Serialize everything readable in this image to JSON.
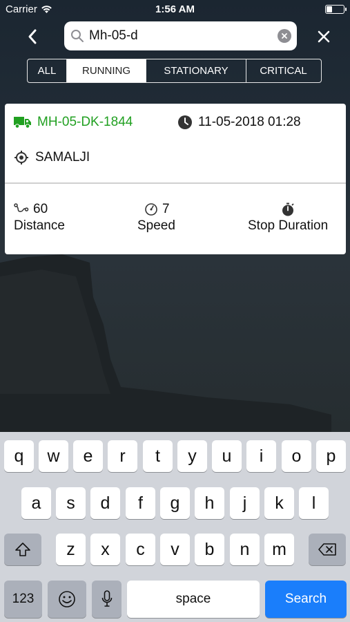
{
  "status_bar": {
    "carrier": "Carrier",
    "time": "1:56 AM"
  },
  "search": {
    "value": "Mh-05-d"
  },
  "filters": [
    {
      "label": "ALL",
      "active": false
    },
    {
      "label": "RUNNING",
      "active": true
    },
    {
      "label": "STATIONARY",
      "active": false
    },
    {
      "label": "CRITICAL",
      "active": false
    }
  ],
  "vehicle": {
    "id": "MH-05-DK-1844",
    "datetime": "11-05-2018 01:28",
    "location": "SAMALJI",
    "distance_value": "60",
    "distance_label": "Distance",
    "speed_value": "7",
    "speed_label": "Speed",
    "stop_label": "Stop Duration",
    "status_color": "#21a021"
  },
  "keyboard": {
    "row1": [
      "q",
      "w",
      "e",
      "r",
      "t",
      "y",
      "u",
      "i",
      "o",
      "p"
    ],
    "row2": [
      "a",
      "s",
      "d",
      "f",
      "g",
      "h",
      "j",
      "k",
      "l"
    ],
    "row3": [
      "z",
      "x",
      "c",
      "v",
      "b",
      "n",
      "m"
    ],
    "numbers_label": "123",
    "space_label": "space",
    "search_label": "Search"
  },
  "colors": {
    "accent": "#1a7efb",
    "running": "#21a021"
  }
}
